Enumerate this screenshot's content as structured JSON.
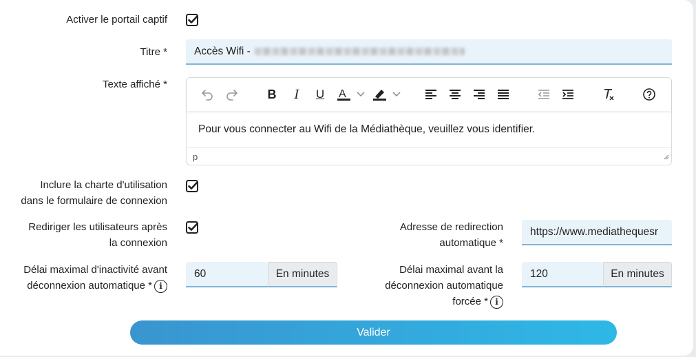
{
  "form": {
    "captive_label": "Activer le portail captif",
    "captive_checked": true,
    "title_label": "Titre *",
    "title_value": "Accès Wifi -",
    "text_label": "Texte affiché *",
    "editor_content": "Pour vous connecter au Wifi de la Médiathèque, veuillez vous identifier.",
    "editor_path": "p",
    "charter_label_line1": "Inclure la charte d'utilisation",
    "charter_label_line2": "dans le formulaire de connexion",
    "charter_checked": true,
    "redirect_label_line1": "Rediriger les utilisateurs après",
    "redirect_label_line2": "la connexion",
    "redirect_checked": true,
    "redirect_url_label_line1": "Adresse de redirection",
    "redirect_url_label_line2": "automatique *",
    "redirect_url_value": "https://www.mediathequesr",
    "idle_label_line1": "Délai maximal d'inactivité avant",
    "idle_label_line2": "déconnexion automatique *",
    "idle_value": "60",
    "idle_unit": "En minutes",
    "forced_label_line1": "Délai maximal avant la",
    "forced_label_line2": "déconnexion automatique",
    "forced_label_line3": "forcée *",
    "forced_value": "120",
    "forced_unit": "En minutes",
    "submit_label": "Valider"
  },
  "toolbar_icons": [
    "undo-icon",
    "redo-icon",
    "bold-icon",
    "italic-icon",
    "underline-icon",
    "text-color-icon",
    "highlight-color-icon",
    "align-left-icon",
    "align-center-icon",
    "align-right-icon",
    "align-justify-icon",
    "outdent-icon",
    "indent-icon",
    "clear-formatting-icon",
    "help-icon"
  ],
  "colors": {
    "accent": "#2eb8e6",
    "input_bg": "#e9f3fa",
    "input_border": "#7fb4d8"
  }
}
